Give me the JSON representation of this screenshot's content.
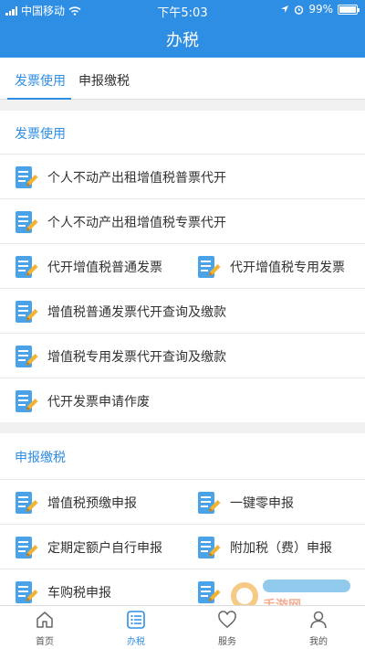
{
  "status_bar": {
    "carrier": "中国移动",
    "time": "下午5:03",
    "battery": "99%",
    "battery_level": 0.99
  },
  "header": {
    "title": "办税"
  },
  "tabs": [
    {
      "label": "发票使用",
      "active": true
    },
    {
      "label": "申报缴税",
      "active": false
    }
  ],
  "sections": [
    {
      "title": "发票使用",
      "items": [
        "个人不动产出租增值税普票代开",
        "个人不动产出租增值税专票代开",
        "代开增值税普通发票",
        "代开增值税专用发票",
        "增值税普通发票代开查询及缴款",
        "增值税专用发票代开查询及缴款",
        "代开发票申请作废"
      ]
    },
    {
      "title": "申报缴税",
      "items": [
        "增值税预缴申报",
        "一键零申报",
        "定期定额户自行申报",
        "附加税（费）申报",
        "车购税申报"
      ]
    }
  ],
  "tabbar": [
    {
      "label": "首页",
      "icon": "home-icon",
      "active": false
    },
    {
      "label": "办税",
      "icon": "list-icon",
      "active": true
    },
    {
      "label": "服务",
      "icon": "heart-icon",
      "active": false
    },
    {
      "label": "我的",
      "icon": "person-icon",
      "active": false
    }
  ],
  "watermark": {
    "text": "手游网"
  },
  "colors": {
    "accent": "#2e8ee3",
    "icon_blue": "#4aa3e8",
    "pencil": "#f2b233"
  }
}
